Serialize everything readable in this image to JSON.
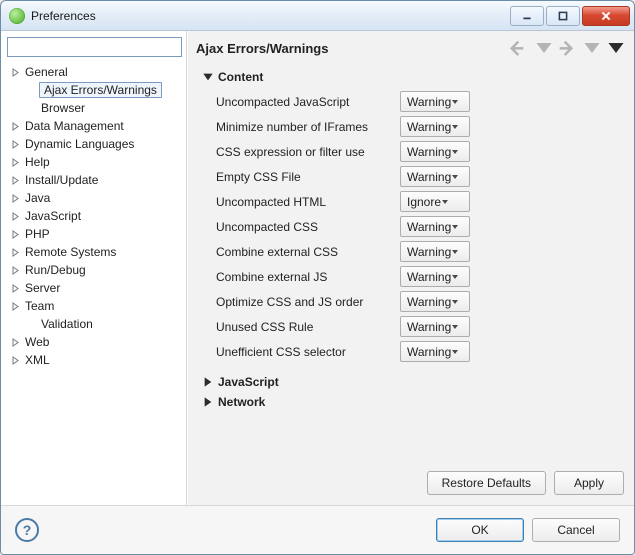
{
  "window": {
    "title": "Preferences"
  },
  "filter_value": "",
  "tree": [
    {
      "label": "General",
      "expandable": true,
      "depth": 0
    },
    {
      "label": "Ajax Errors/Warnings",
      "expandable": false,
      "depth": 1,
      "selected": true
    },
    {
      "label": "Browser",
      "expandable": false,
      "depth": 1
    },
    {
      "label": "Data Management",
      "expandable": true,
      "depth": 0
    },
    {
      "label": "Dynamic Languages",
      "expandable": true,
      "depth": 0
    },
    {
      "label": "Help",
      "expandable": true,
      "depth": 0
    },
    {
      "label": "Install/Update",
      "expandable": true,
      "depth": 0
    },
    {
      "label": "Java",
      "expandable": true,
      "depth": 0
    },
    {
      "label": "JavaScript",
      "expandable": true,
      "depth": 0
    },
    {
      "label": "PHP",
      "expandable": true,
      "depth": 0
    },
    {
      "label": "Remote Systems",
      "expandable": true,
      "depth": 0
    },
    {
      "label": "Run/Debug",
      "expandable": true,
      "depth": 0
    },
    {
      "label": "Server",
      "expandable": true,
      "depth": 0
    },
    {
      "label": "Team",
      "expandable": true,
      "depth": 0
    },
    {
      "label": "Validation",
      "expandable": false,
      "depth": 1
    },
    {
      "label": "Web",
      "expandable": true,
      "depth": 0
    },
    {
      "label": "XML",
      "expandable": true,
      "depth": 0
    }
  ],
  "pane": {
    "title": "Ajax Errors/Warnings",
    "sections": [
      {
        "name": "Content",
        "expanded": true,
        "rows": [
          {
            "label": "Uncompacted JavaScript",
            "value": "Warning"
          },
          {
            "label": "Minimize number of IFrames",
            "value": "Warning"
          },
          {
            "label": "CSS expression or filter use",
            "value": "Warning"
          },
          {
            "label": "Empty CSS File",
            "value": "Warning"
          },
          {
            "label": "Uncompacted HTML",
            "value": "Ignore"
          },
          {
            "label": "Uncompacted CSS",
            "value": "Warning"
          },
          {
            "label": "Combine external CSS",
            "value": "Warning"
          },
          {
            "label": "Combine external JS",
            "value": "Warning"
          },
          {
            "label": "Optimize CSS and JS order",
            "value": "Warning"
          },
          {
            "label": "Unused CSS Rule",
            "value": "Warning"
          },
          {
            "label": "Unefficient CSS selector",
            "value": "Warning"
          }
        ]
      },
      {
        "name": "JavaScript",
        "expanded": false
      },
      {
        "name": "Network",
        "expanded": false
      }
    ],
    "buttons": {
      "restore": "Restore Defaults",
      "apply": "Apply"
    }
  },
  "dialog": {
    "ok": "OK",
    "cancel": "Cancel"
  }
}
